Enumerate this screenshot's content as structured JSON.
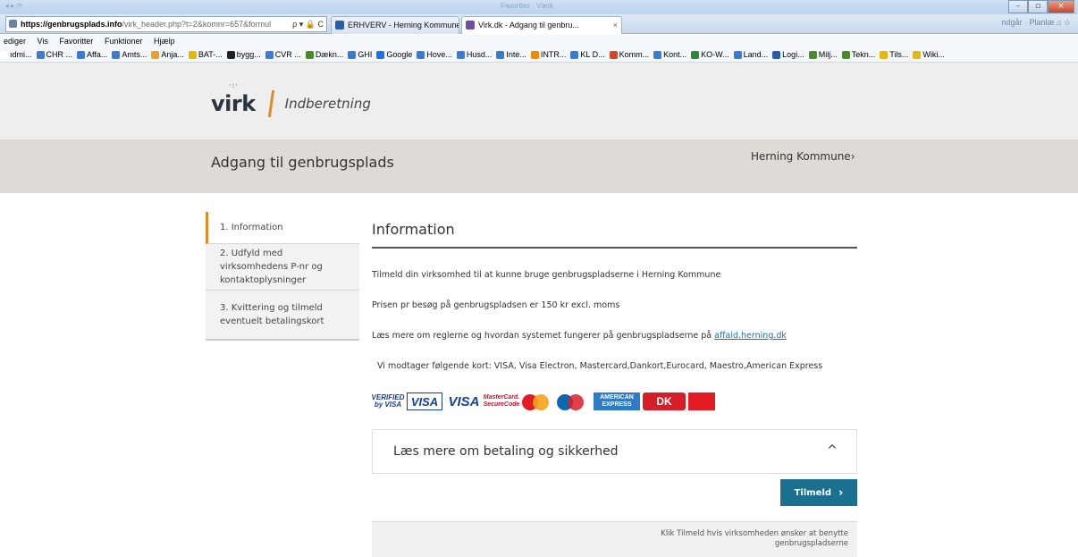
{
  "browser": {
    "title_faint": "Favorites · Værk",
    "address": {
      "host": "https://genbrugsplads.info",
      "path": "/virk_header.php?t=2&komnr=657&formul",
      "tools": "ρ ▾ 🔒 C"
    },
    "tabs": [
      {
        "label": "ERHVERV - Herning Kommune",
        "icon_color": "#2a5caa"
      },
      {
        "label": "Virk.dk - Adgang til genbru...",
        "icon_color": "#6b4fa0",
        "close": "×"
      }
    ],
    "nav_right": "ndgår · Planlæ   ⌂ ☆",
    "menu": [
      "ediger",
      "Vis",
      "Favoritter",
      "Funktioner",
      "Hjælp"
    ],
    "favorites": [
      {
        "label": "ıdmi...",
        "color": "#ffffff"
      },
      {
        "label": "CHR ...",
        "color": "#3a7bd5"
      },
      {
        "label": "Affa...",
        "color": "#3a7bd5"
      },
      {
        "label": "Amts...",
        "color": "#3a7bd5"
      },
      {
        "label": "Anja...",
        "color": "#f0a020"
      },
      {
        "label": "BAT-...",
        "color": "#e6b800"
      },
      {
        "label": "bygg...",
        "color": "#222222"
      },
      {
        "label": "CVR ...",
        "color": "#3a7bd5"
      },
      {
        "label": "Dækn...",
        "color": "#4a8a2a"
      },
      {
        "label": "GHI",
        "color": "#3a7bd5"
      },
      {
        "label": "Google",
        "color": "#1a73e8"
      },
      {
        "label": "Hove...",
        "color": "#3a7bd5"
      },
      {
        "label": "Husd...",
        "color": "#3a7bd5"
      },
      {
        "label": "Inte...",
        "color": "#3a7bd5"
      },
      {
        "label": "INTR...",
        "color": "#f08a00"
      },
      {
        "label": "KL D...",
        "color": "#3a7bd5"
      },
      {
        "label": "Komm...",
        "color": "#d04a2a"
      },
      {
        "label": "Kont...",
        "color": "#3a7bd5"
      },
      {
        "label": "KO-W...",
        "color": "#2a8a3a"
      },
      {
        "label": "Land...",
        "color": "#3a7bd5"
      },
      {
        "label": "Logi...",
        "color": "#2a5caa"
      },
      {
        "label": "Milj...",
        "color": "#4a8a2a"
      },
      {
        "label": "Tekn...",
        "color": "#4a8a2a"
      },
      {
        "label": "Tils...",
        "color": "#e6b800"
      },
      {
        "label": "Wiki...",
        "color": "#e6b800"
      }
    ]
  },
  "header": {
    "logo_dots": "·:·",
    "logo_text": "virk",
    "logo_subtitle": "Indberetning",
    "page_title": "Adgang til genbrugsplads",
    "kommune_link": "Herning Kommune›"
  },
  "steps": [
    {
      "label": "1. Information"
    },
    {
      "label": "2. Udfyld med virksomhedens P-nr og kontaktoplysninger"
    },
    {
      "label": "3. Kvittering og tilmeld eventuelt betalingskort"
    }
  ],
  "content": {
    "heading": "Information",
    "p1": "Tilmeld din virksomhed til at kunne bruge genbrugspladserne i Herning Kommune",
    "p2": "Prisen pr besøg på genbrugspladsen er 150 kr excl. moms",
    "p3_text": "Læs mere om reglerne og hvordan systemet fungerer på genbrugspladserne på ",
    "p3_link": "affald.herning.dk",
    "p4": "Vi modtager følgende kort: VISA, Visa Electron, Mastercard,Dankort,Eurocard, Maestro,American Express",
    "cards": {
      "vbv_top": "VERIFIED",
      "vbv_bottom": "by VISA",
      "visa_electron": "VISA",
      "visa": "VISA",
      "msc_top": "MasterCard.",
      "msc_bottom": "SecureCode",
      "amex_top": "AMERICAN",
      "amex_bottom": "EXPRESS",
      "dankort": "DK"
    },
    "accordion_title": "Læs mere om betaling og sikkerhed",
    "accordion_icon": "^",
    "button_label": "Tilmeld",
    "button_icon": "›",
    "footer_text": "Klik Tilmeld hvis virksomheden ønsker at benytte genbrugspladserne"
  }
}
